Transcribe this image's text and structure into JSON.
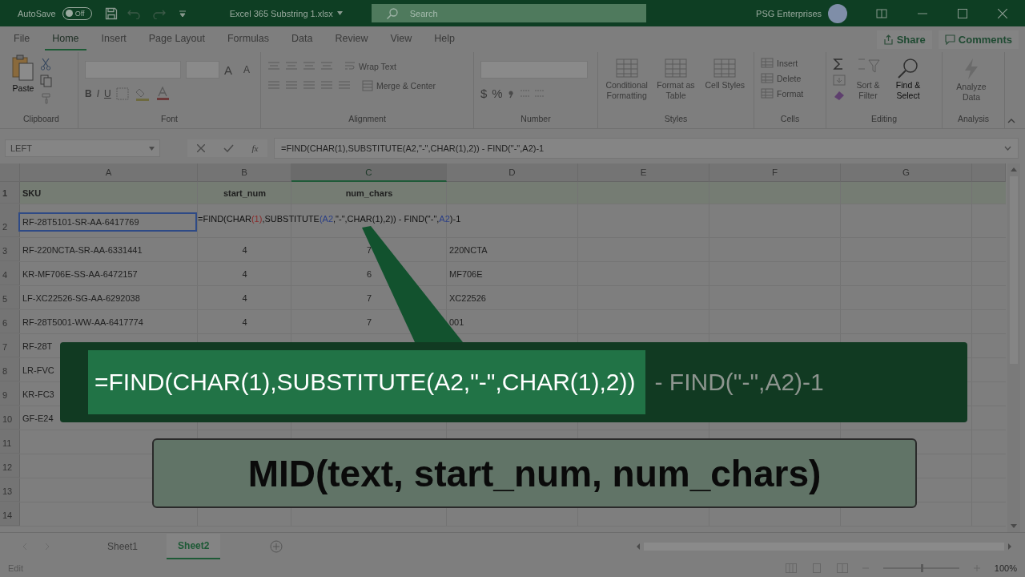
{
  "title_bar": {
    "autosave_label": "AutoSave",
    "autosave_state": "Off",
    "autosave_on": false,
    "file_name": "Excel 365  Substring 1.xlsx",
    "search_placeholder": "Search",
    "user": "PSG Enterprises"
  },
  "menu_tabs": [
    {
      "label": "File",
      "selected": false
    },
    {
      "label": "Home",
      "selected": true
    },
    {
      "label": "Insert",
      "selected": false
    },
    {
      "label": "Page Layout",
      "selected": false
    },
    {
      "label": "Formulas",
      "selected": false
    },
    {
      "label": "Data",
      "selected": false
    },
    {
      "label": "Review",
      "selected": false
    },
    {
      "label": "View",
      "selected": false
    },
    {
      "label": "Help",
      "selected": false
    }
  ],
  "share": "Share",
  "comments": "Comments",
  "ribbon_groups": [
    {
      "kind": "clipboard",
      "name": "Clipboard",
      "items": [
        {
          "label": "Paste",
          "disabled": false
        }
      ]
    },
    {
      "kind": "font",
      "name": "Font",
      "items": [
        {
          "label": "A",
          "disabled": true
        },
        {
          "label": "A",
          "disabled": true
        },
        {
          "label": "B",
          "disabled": true
        },
        {
          "label": "I",
          "disabled": true
        },
        {
          "label": "U",
          "disabled": true
        }
      ]
    },
    {
      "kind": "alignment",
      "name": "Alignment",
      "items": [
        {
          "label": "Wrap Text",
          "disabled": true
        },
        {
          "label": "Merge & Center",
          "disabled": true
        }
      ]
    },
    {
      "kind": "number",
      "name": "Number",
      "items": [
        {
          "label": "$",
          "disabled": true
        },
        {
          "label": "%",
          "disabled": true
        }
      ]
    },
    {
      "kind": "styles",
      "name": "Styles",
      "items": [
        {
          "label": "Conditional Formatting",
          "disabled": true
        },
        {
          "label": "Format as Table",
          "disabled": true
        },
        {
          "label": "Cell Styles",
          "disabled": true
        }
      ]
    },
    {
      "kind": "cells",
      "name": "Cells",
      "items": [
        {
          "label": "Insert",
          "disabled": true
        },
        {
          "label": "Delete",
          "disabled": true
        },
        {
          "label": "Format",
          "disabled": true
        }
      ]
    },
    {
      "kind": "editing",
      "name": "Editing",
      "items": [
        {
          "label": "Sort & Filter",
          "disabled": true
        },
        {
          "label": "Find & Select",
          "disabled": false
        }
      ]
    },
    {
      "kind": "analysis",
      "name": "Analysis",
      "items": [
        {
          "label": "Analyze Data",
          "disabled": true
        }
      ]
    }
  ],
  "formula_bar": {
    "name_box": "LEFT",
    "fx": "fx",
    "value": "=FIND(CHAR(1),SUBSTITUTE(A2,\"-\",CHAR(1),2)) - FIND(\"-\",A2)-1"
  },
  "columns": [
    {
      "label": "A",
      "selected": false
    },
    {
      "label": "B",
      "selected": false
    },
    {
      "label": "C",
      "selected": true
    },
    {
      "label": "D",
      "selected": false
    },
    {
      "label": "E",
      "selected": false
    },
    {
      "label": "F",
      "selected": false
    },
    {
      "label": "G",
      "selected": false
    }
  ],
  "rows": [
    {
      "num": "1",
      "kind": "header",
      "a": "SKU",
      "b": "start_num",
      "c": "num_chars"
    },
    {
      "num": "2",
      "kind": "formula",
      "a": "RF-28T5101-SR-AA-6417769",
      "a_selected": true,
      "formula": [
        {
          "text": "=FIND(CHAR",
          "color": "#111111"
        },
        {
          "text": "(1)",
          "color": "#8a2a2a"
        },
        {
          "text": ",SUBSTITUTE",
          "color": "#111111"
        },
        {
          "text": "(A2",
          "color": "#2b3f86"
        },
        {
          "text": ",\"-\",CHAR(1),2))",
          "color": "#111111"
        },
        {
          "text": " - FIND(\"-\",",
          "color": "#111111"
        },
        {
          "text": "A2",
          "color": "#2b3f86"
        },
        {
          "text": ")-1",
          "color": "#111111"
        }
      ]
    },
    {
      "num": "3",
      "kind": "data",
      "a": "RF-220NCTA-SR-AA-6331441",
      "b": "4",
      "c": "7",
      "d": "220NCTA"
    },
    {
      "num": "4",
      "kind": "data",
      "a": "KR-MF706E-SS-AA-6472157",
      "b": "4",
      "c": "6",
      "d": "MF706E"
    },
    {
      "num": "5",
      "kind": "data",
      "a": "LF-XC22526-SG-AA-6292038",
      "b": "4",
      "c": "7",
      "d": "XC22526"
    },
    {
      "num": "6",
      "kind": "data",
      "a": "RF-28T5001-WW-AA-6417774",
      "b": "4",
      "c": "7",
      "d": "001"
    },
    {
      "num": "7",
      "kind": "data",
      "a": "RF-28T"
    },
    {
      "num": "8",
      "kind": "data",
      "a": "LR-FVC"
    },
    {
      "num": "9",
      "kind": "data",
      "a": "KR-FC3"
    },
    {
      "num": "10",
      "kind": "data",
      "a": "GF-E24"
    },
    {
      "num": "11",
      "kind": "data"
    },
    {
      "num": "12",
      "kind": "data"
    },
    {
      "num": "13",
      "kind": "data"
    },
    {
      "num": "14",
      "kind": "data"
    }
  ],
  "overlay": {
    "highlighted": "=FIND(CHAR(1),SUBSTITUTE(A2,\"-\",CHAR(1),2))",
    "rest": "- FIND(\"-\",A2)-1",
    "syntax": "MID(text, start_num, num_chars)"
  },
  "sheet_tabs": [
    {
      "label": "Sheet1",
      "selected": false
    },
    {
      "label": "Sheet2",
      "selected": true
    }
  ],
  "status_bar": {
    "mode": "Edit",
    "zoom": "100%",
    "zoom_slider": {
      "level": 0.5
    }
  }
}
